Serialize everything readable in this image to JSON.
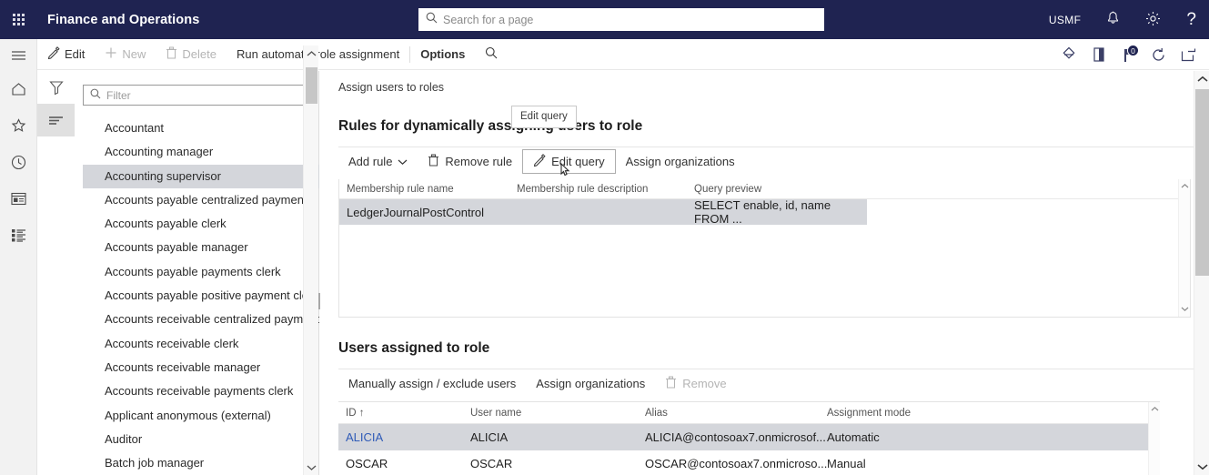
{
  "topnav": {
    "waffle_icon": "waffle-grid-icon",
    "app_title": "Finance and Operations",
    "search_placeholder": "Search for a page",
    "search_icon": "search-icon",
    "company": "USMF",
    "notifications_icon": "bell-icon",
    "settings_icon": "gear-icon",
    "help_icon": "question-mark-icon"
  },
  "rail": {
    "items": [
      {
        "name": "menu-hamburger-icon"
      },
      {
        "name": "home-icon"
      },
      {
        "name": "favorites-star-icon"
      },
      {
        "name": "recent-clock-icon"
      },
      {
        "name": "workspaces-icon"
      },
      {
        "name": "modules-list-icon"
      }
    ]
  },
  "actionpane": {
    "edit": "Edit",
    "new": "New",
    "delete": "Delete",
    "run_auto": "Run automatic role assignment",
    "options": "Options",
    "search_icon": "search-icon",
    "right_icons": [
      {
        "name": "personalize-diamond-icon"
      },
      {
        "name": "attachments-icon"
      },
      {
        "name": "notification-flag-icon",
        "badge": "0"
      },
      {
        "name": "refresh-icon"
      },
      {
        "name": "open-in-new-window-icon"
      }
    ]
  },
  "listpanel": {
    "filter_icon": "filter-funnel-icon",
    "list_icon": "list-lines-icon",
    "filter_placeholder": "Filter",
    "filter_search_icon": "search-icon",
    "selected": "Accounting supervisor",
    "items": [
      "Accountant",
      "Accounting manager",
      "Accounting supervisor",
      "Accounts payable centralized payments",
      "Accounts payable clerk",
      "Accounts payable manager",
      "Accounts payable payments clerk",
      "Accounts payable positive payment clerk",
      "Accounts receivable centralized payments",
      "Accounts receivable clerk",
      "Accounts receivable manager",
      "Accounts receivable payments clerk",
      "Applicant anonymous (external)",
      "Auditor",
      "Batch job manager"
    ]
  },
  "main": {
    "breadcrumb": "Assign users to roles",
    "rules": {
      "title": "Rules for dynamically assigning users to role",
      "toolbar": {
        "add_rule": "Add rule",
        "add_rule_chevron": "chevron-down-icon",
        "remove_rule": "Remove rule",
        "remove_rule_icon": "trash-icon",
        "edit_query": "Edit query",
        "edit_query_icon": "pencil-icon",
        "assign_organizations": "Assign organizations"
      },
      "tooltip": "Edit query",
      "columns": [
        "Membership rule name",
        "Membership rule description",
        "Query preview"
      ],
      "rows": [
        {
          "name": "LedgerJournalPostControl",
          "description": "",
          "query_preview": "SELECT enable, id, name FROM ..."
        }
      ]
    },
    "users": {
      "title": "Users assigned to role",
      "toolbar": {
        "manually_assign": "Manually assign / exclude users",
        "assign_organizations": "Assign organizations",
        "remove": "Remove",
        "remove_icon": "trash-icon"
      },
      "columns": [
        "ID",
        "User name",
        "Alias",
        "Assignment mode"
      ],
      "sort_indicator": "↑",
      "rows": [
        {
          "id": "ALICIA",
          "user_name": "ALICIA",
          "alias": "ALICIA@contosoax7.onmicrosof...",
          "mode": "Automatic"
        },
        {
          "id": "OSCAR",
          "user_name": "OSCAR",
          "alias": "OSCAR@contosoax7.onmicroso...",
          "mode": "Manual"
        }
      ]
    }
  },
  "colors": {
    "header_navy": "#1f2351",
    "selection_grey": "#d4d6db",
    "link_blue": "#2f5bb7",
    "disabled_grey": "#b4b4b4"
  }
}
